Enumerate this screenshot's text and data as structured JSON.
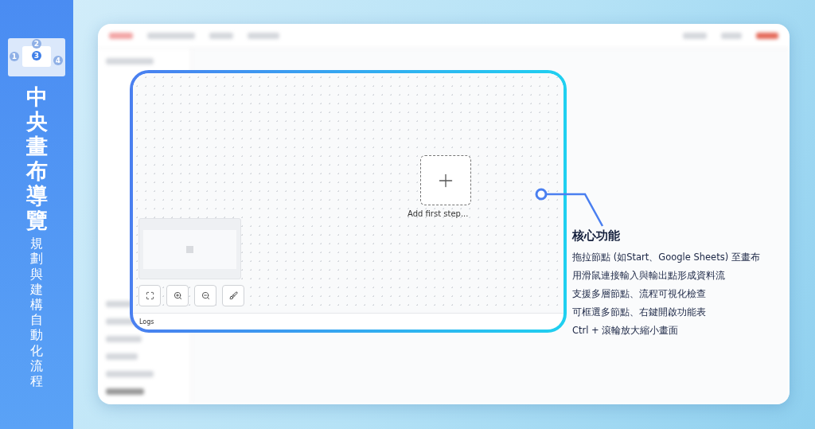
{
  "banner": {
    "title": "中央畫布導覽",
    "subtitle": "規劃與建構自動化流程",
    "layout_badges": [
      "1",
      "2",
      "3",
      "4"
    ]
  },
  "canvas": {
    "node_label": "Add first step...",
    "logs_label": "Logs"
  },
  "callout": {
    "heading": "核心功能",
    "lines": [
      "拖拉節點 (如Start、Google Sheets) 至畫布",
      "用滑鼠連接輸入與輸出點形成資料流",
      "支援多層節點、流程可視化檢查",
      "可框選多節點、右鍵開啟功能表",
      "Ctrl + 滾輪放大縮小畫面"
    ]
  }
}
